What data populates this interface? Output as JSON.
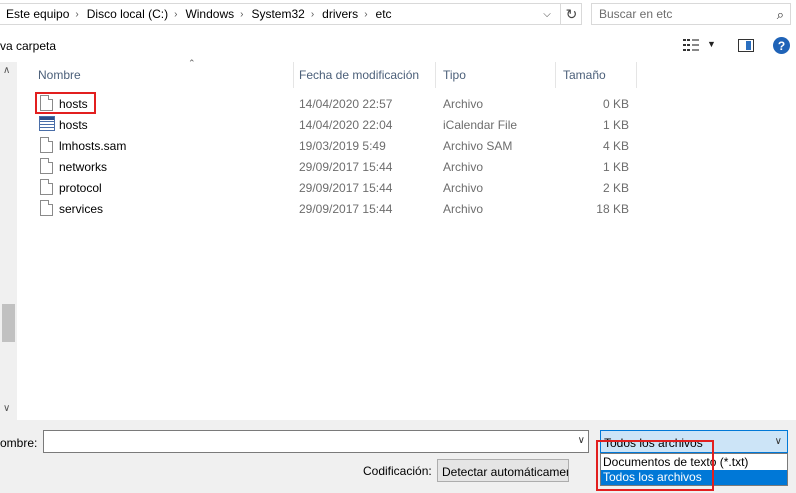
{
  "address_bar": {
    "crumbs": [
      "Este equipo",
      "Disco local (C:)",
      "Windows",
      "System32",
      "drivers",
      "etc"
    ],
    "search_placeholder": "Buscar en etc"
  },
  "toolbar": {
    "new_folder_label": "va carpeta"
  },
  "columns": {
    "name": "Nombre",
    "date": "Fecha de modificación",
    "type": "Tipo",
    "size": "Tamaño"
  },
  "files": [
    {
      "name": "hosts",
      "date": "14/04/2020 22:57",
      "type": "Archivo",
      "size": "0 KB",
      "icon": "document-icon"
    },
    {
      "name": "hosts",
      "date": "14/04/2020 22:04",
      "type": "iCalendar File",
      "size": "1 KB",
      "icon": "calendar-file-icon"
    },
    {
      "name": "lmhosts.sam",
      "date": "19/03/2019 5:49",
      "type": "Archivo SAM",
      "size": "4 KB",
      "icon": "document-icon"
    },
    {
      "name": "networks",
      "date": "29/09/2017 15:44",
      "type": "Archivo",
      "size": "1 KB",
      "icon": "document-icon"
    },
    {
      "name": "protocol",
      "date": "29/09/2017 15:44",
      "type": "Archivo",
      "size": "2 KB",
      "icon": "document-icon"
    },
    {
      "name": "services",
      "date": "29/09/2017 15:44",
      "type": "Archivo",
      "size": "18 KB",
      "icon": "document-icon"
    }
  ],
  "bottom": {
    "name_label": "ombre:",
    "name_value": "",
    "type_selected": "Todos los archivos",
    "type_options": [
      "Documentos de texto (*.txt)",
      "Todos los archivos"
    ],
    "encoding_label": "Codificación:",
    "encoding_value": "Detectar automáticamente"
  },
  "colors": {
    "highlight": "#e21f1f",
    "selection": "#0078d7",
    "select_bg": "#cce4f7"
  }
}
